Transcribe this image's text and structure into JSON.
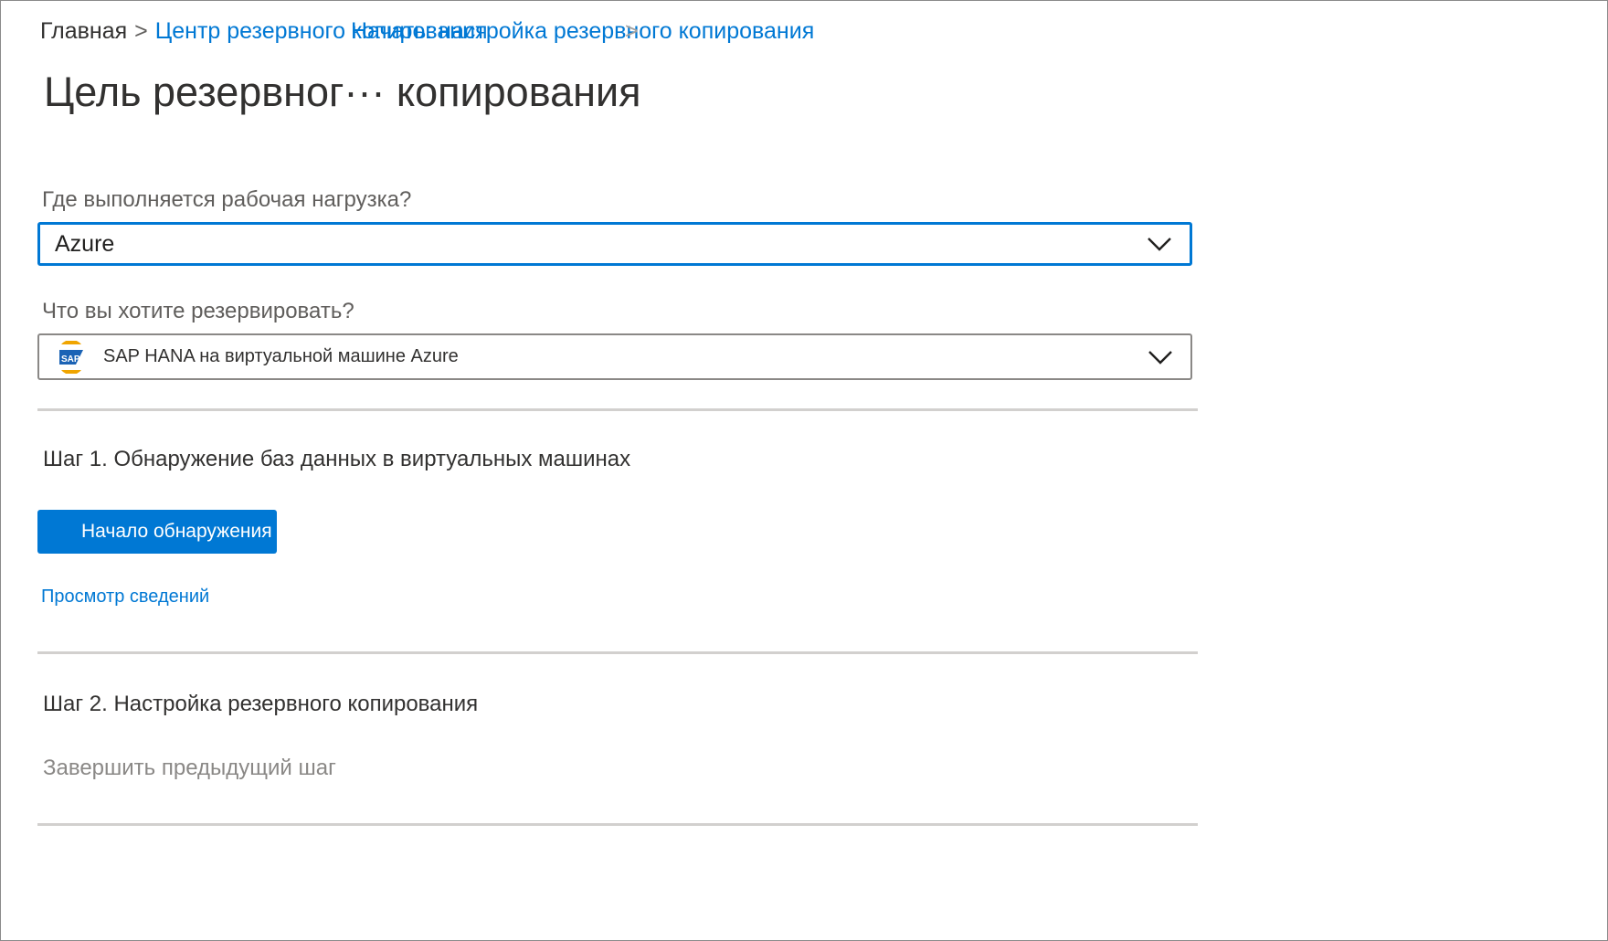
{
  "breadcrumb": {
    "home": "Главная",
    "separator": ">",
    "center": "Центр резервного копирования",
    "current": "Начать: настройка резервного копирования",
    "ghost_separator": ">"
  },
  "page_title": "Цель резервног··· копирования",
  "workload": {
    "label": "Где выполняется рабочая нагрузка?",
    "value": "Azure",
    "icon": "chevron-down-icon"
  },
  "backup_target": {
    "label": "Что вы хотите резервировать?",
    "value": "SAP HANA на виртуальной машине Azure",
    "logo": "sap-logo",
    "logo_text": "SAP",
    "icon": "chevron-down-icon"
  },
  "step1": {
    "heading": "Шаг 1. Обнаружение баз данных в виртуальных машинах",
    "button_label": "Начало обнаружения",
    "details_link": "Просмотр сведений"
  },
  "step2": {
    "heading": "Шаг 2. Настройка резервного копирования",
    "status": "Завершить предыдущий шаг"
  },
  "colors": {
    "accent": "#0078d4",
    "text": "#323130",
    "muted": "#8a8886",
    "divider": "#d2d0ce",
    "sap_orange": "#f0a500"
  }
}
